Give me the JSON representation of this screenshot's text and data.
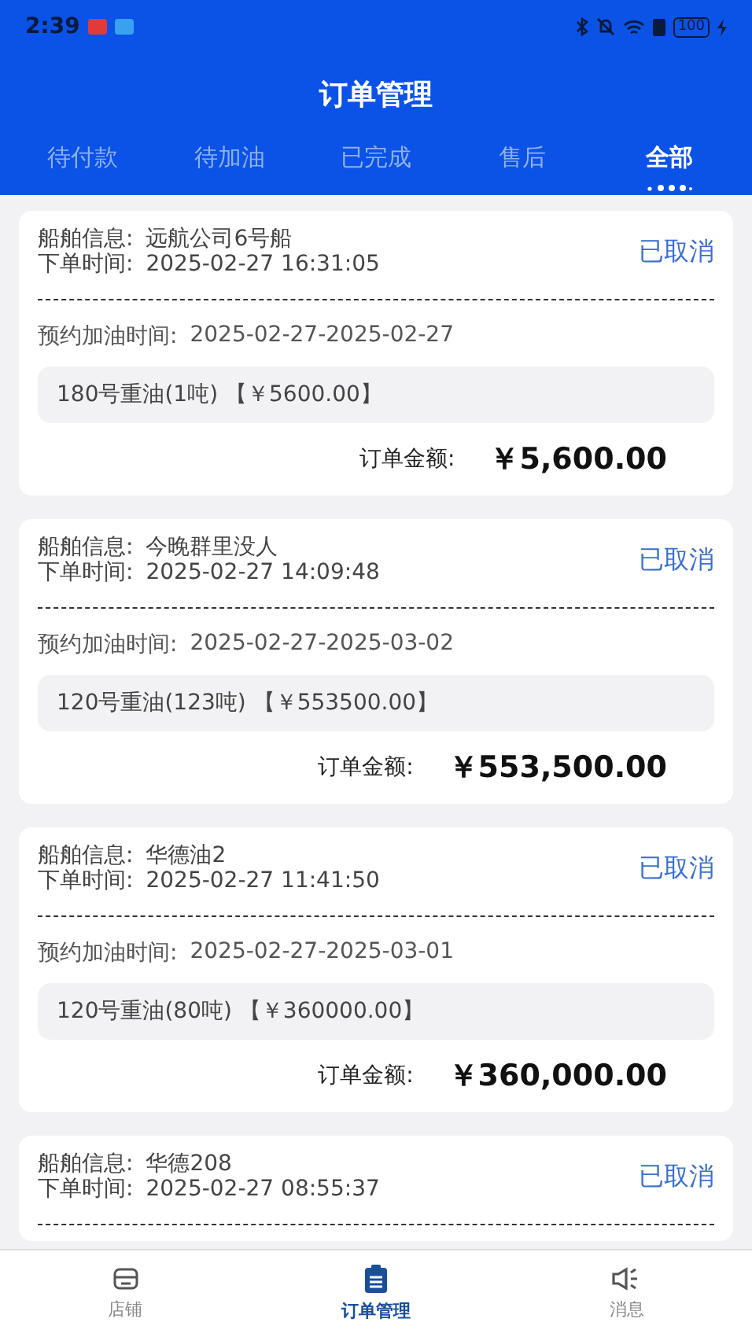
{
  "status_bar": {
    "time": "2:39",
    "battery": "100"
  },
  "header": {
    "title": "订单管理"
  },
  "tabs": [
    {
      "label": "待付款",
      "selected": false
    },
    {
      "label": "待加油",
      "selected": false
    },
    {
      "label": "已完成",
      "selected": false
    },
    {
      "label": "售后",
      "selected": false
    },
    {
      "label": "全部",
      "selected": true
    }
  ],
  "orders": [
    {
      "ship_label": "船舶信息:",
      "ship": "远航公司6号船",
      "time_label": "下单时间:",
      "time": "2025-02-27 16:31:05",
      "status": "已取消",
      "reserve_label": "预约加油时间:",
      "reserve": "2025-02-27-2025-02-27",
      "item": "180号重油(1吨) 【￥5600.00】",
      "amount_label": "订单金额:",
      "amount": "￥5,600.00"
    },
    {
      "ship_label": "船舶信息:",
      "ship": "今晚群里没人",
      "time_label": "下单时间:",
      "time": "2025-02-27 14:09:48",
      "status": "已取消",
      "reserve_label": "预约加油时间:",
      "reserve": "2025-02-27-2025-03-02",
      "item": "120号重油(123吨) 【￥553500.00】",
      "amount_label": "订单金额:",
      "amount": "￥553,500.00"
    },
    {
      "ship_label": "船舶信息:",
      "ship": "华德油2",
      "time_label": "下单时间:",
      "time": "2025-02-27 11:41:50",
      "status": "已取消",
      "reserve_label": "预约加油时间:",
      "reserve": "2025-02-27-2025-03-01",
      "item": "120号重油(80吨) 【￥360000.00】",
      "amount_label": "订单金额:",
      "amount": "￥360,000.00"
    },
    {
      "ship_label": "船舶信息:",
      "ship": "华德208",
      "time_label": "下单时间:",
      "time": "2025-02-27 08:55:37",
      "status": "已取消"
    }
  ],
  "bottom_nav": [
    {
      "label": "店铺",
      "kind": "store",
      "selected": false
    },
    {
      "label": "订单管理",
      "kind": "clipboard",
      "selected": true
    },
    {
      "label": "消息",
      "kind": "speaker",
      "selected": false
    }
  ]
}
